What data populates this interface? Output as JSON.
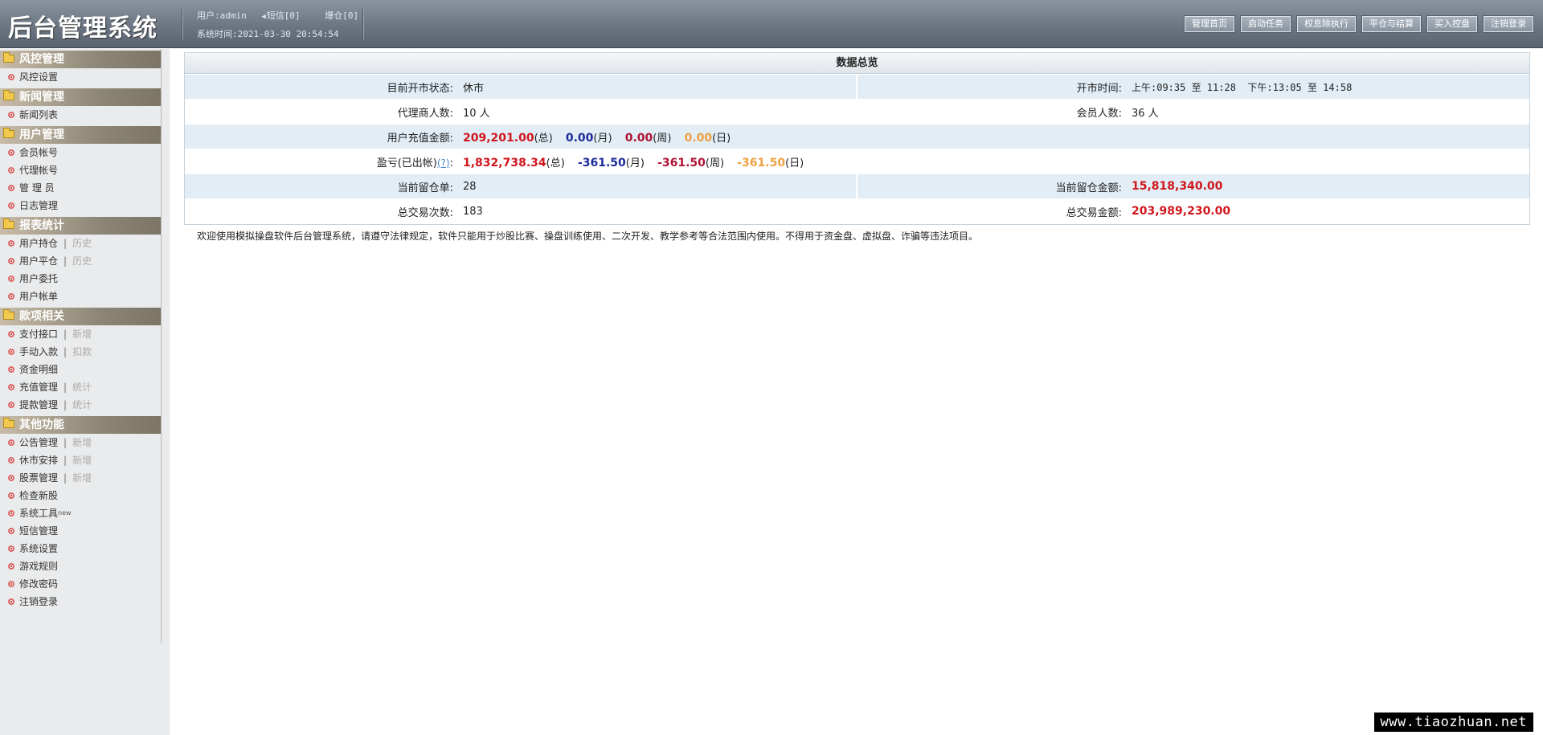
{
  "header": {
    "title": "后台管理系统",
    "user": "用户:admin",
    "sms": "短信[0]",
    "blowup": "爆仓[0]",
    "system_time": "系统时间:2021-03-30 20:54:54",
    "buttons": [
      "管理首页",
      "启动任务",
      "权息除执行",
      "平仓与结算",
      "买入控盘",
      "注销登录"
    ]
  },
  "sidebar": {
    "groups": [
      {
        "title": "风控管理",
        "items": [
          {
            "label": "风控设置"
          }
        ]
      },
      {
        "title": "新闻管理",
        "items": [
          {
            "label": "新闻列表"
          }
        ]
      },
      {
        "title": "用户管理",
        "items": [
          {
            "label": "会员帐号"
          },
          {
            "label": "代理帐号"
          },
          {
            "label": "管 理 员"
          },
          {
            "label": "日志管理"
          }
        ]
      },
      {
        "title": "报表统计",
        "items": [
          {
            "label": "用户持仓",
            "sub": "历史"
          },
          {
            "label": "用户平仓",
            "sub": "历史"
          },
          {
            "label": "用户委托"
          },
          {
            "label": "用户帐单"
          }
        ]
      },
      {
        "title": "款项相关",
        "items": [
          {
            "label": "支付接口",
            "sub": "新增"
          },
          {
            "label": "手动入款",
            "sub": "扣款"
          },
          {
            "label": "资金明细"
          },
          {
            "label": "充值管理",
            "sub": "统计"
          },
          {
            "label": "提款管理",
            "sub": "统计"
          }
        ]
      },
      {
        "title": "其他功能",
        "items": [
          {
            "label": "公告管理",
            "sub": "新增"
          },
          {
            "label": "休市安排",
            "sub": "新增"
          },
          {
            "label": "股票管理",
            "sub": "新增"
          },
          {
            "label": "检查新股"
          },
          {
            "label": "系统工具",
            "sup": "new"
          },
          {
            "label": "短信管理"
          },
          {
            "label": "系统设置"
          },
          {
            "label": "游戏规则"
          },
          {
            "label": "修改密码"
          },
          {
            "label": "注销登录"
          }
        ]
      }
    ]
  },
  "overview": {
    "title": "数据总览",
    "market_status_label": "目前开市状态:",
    "market_status": "休市",
    "open_time_label": "开市时间:",
    "open_time": "上午:09:35 至 11:28  下午:13:05 至 14:58",
    "agents_label": "代理商人数:",
    "agents": "10 人",
    "members_label": "会员人数:",
    "members": "36 人",
    "recharge_label": "用户充值金额:",
    "recharge_total": "209,201.00",
    "recharge_month": "0.00",
    "recharge_week": "0.00",
    "recharge_day": "0.00",
    "pnl_label": "盈亏(已出帐)",
    "pnl_help": "(?)",
    "pnl_colon": ":",
    "pnl_total": "1,832,738.34",
    "pnl_month": "-361.50",
    "pnl_week": "-361.50",
    "pnl_day": "-361.50",
    "unit_total": "(总)",
    "unit_month": "(月)",
    "unit_week": "(周)",
    "unit_day": "(日)",
    "open_orders_label": "当前留仓单:",
    "open_orders": "28",
    "open_amount_label": "当前留仓金额:",
    "open_amount": "15,818,340.00",
    "trades_label": "总交易次数:",
    "trades": "183",
    "trade_amount_label": "总交易金额:",
    "trade_amount": "203,989,230.00"
  },
  "notice": "欢迎使用模拟操盘软件后台管理系统，请遵守法律规定，软件只能用于炒股比赛、操盘训练使用、二次开发、教学参考等合法范围内使用。不得用于资金盘、虚拟盘、诈骗等违法项目。",
  "watermark": "www.tiaozhuan.net"
}
